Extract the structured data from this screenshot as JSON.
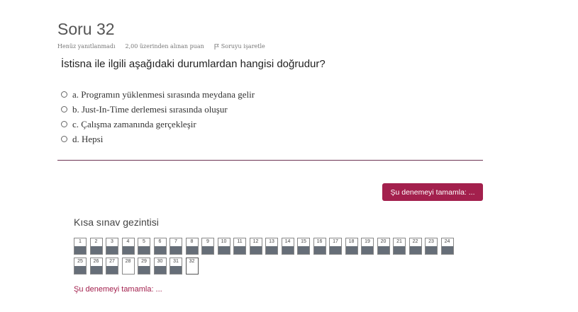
{
  "question": {
    "title": "Soru 32",
    "status": "Henüz yanıtlanmadı",
    "points": "2,00 üzerinden alınan puan",
    "flag_label": "Soruyu işaretle",
    "text": "İstisna ile ilgili aşağıdaki durumlardan hangisi doğrudur?",
    "answers": [
      "a. Programın yüklenmesi sırasında meydana gelir",
      "b. Just-In-Time derlemesi sırasında oluşur",
      "c. Çalışma zamanında gerçekleşir",
      "d. Hepsi"
    ]
  },
  "finish_button": "Şu denemeyi tamamla: ...",
  "navigation": {
    "heading": "Kısa sınav gezintisi",
    "buttons": [
      "1",
      "2",
      "3",
      "4",
      "5",
      "6",
      "7",
      "8",
      "9",
      "10",
      "11",
      "12",
      "13",
      "14",
      "15",
      "16",
      "17",
      "18",
      "19",
      "20",
      "21",
      "22",
      "23",
      "24",
      "25",
      "26",
      "27",
      "28",
      "29",
      "30",
      "31",
      "32"
    ],
    "unanswered": [
      "28",
      "32"
    ],
    "current": "32"
  },
  "finish_link": "Şu denemeyi tamamla: ...",
  "colors": {
    "accent": "#a3204d",
    "divider": "#6e3454",
    "nav_fill": "#666e78"
  }
}
